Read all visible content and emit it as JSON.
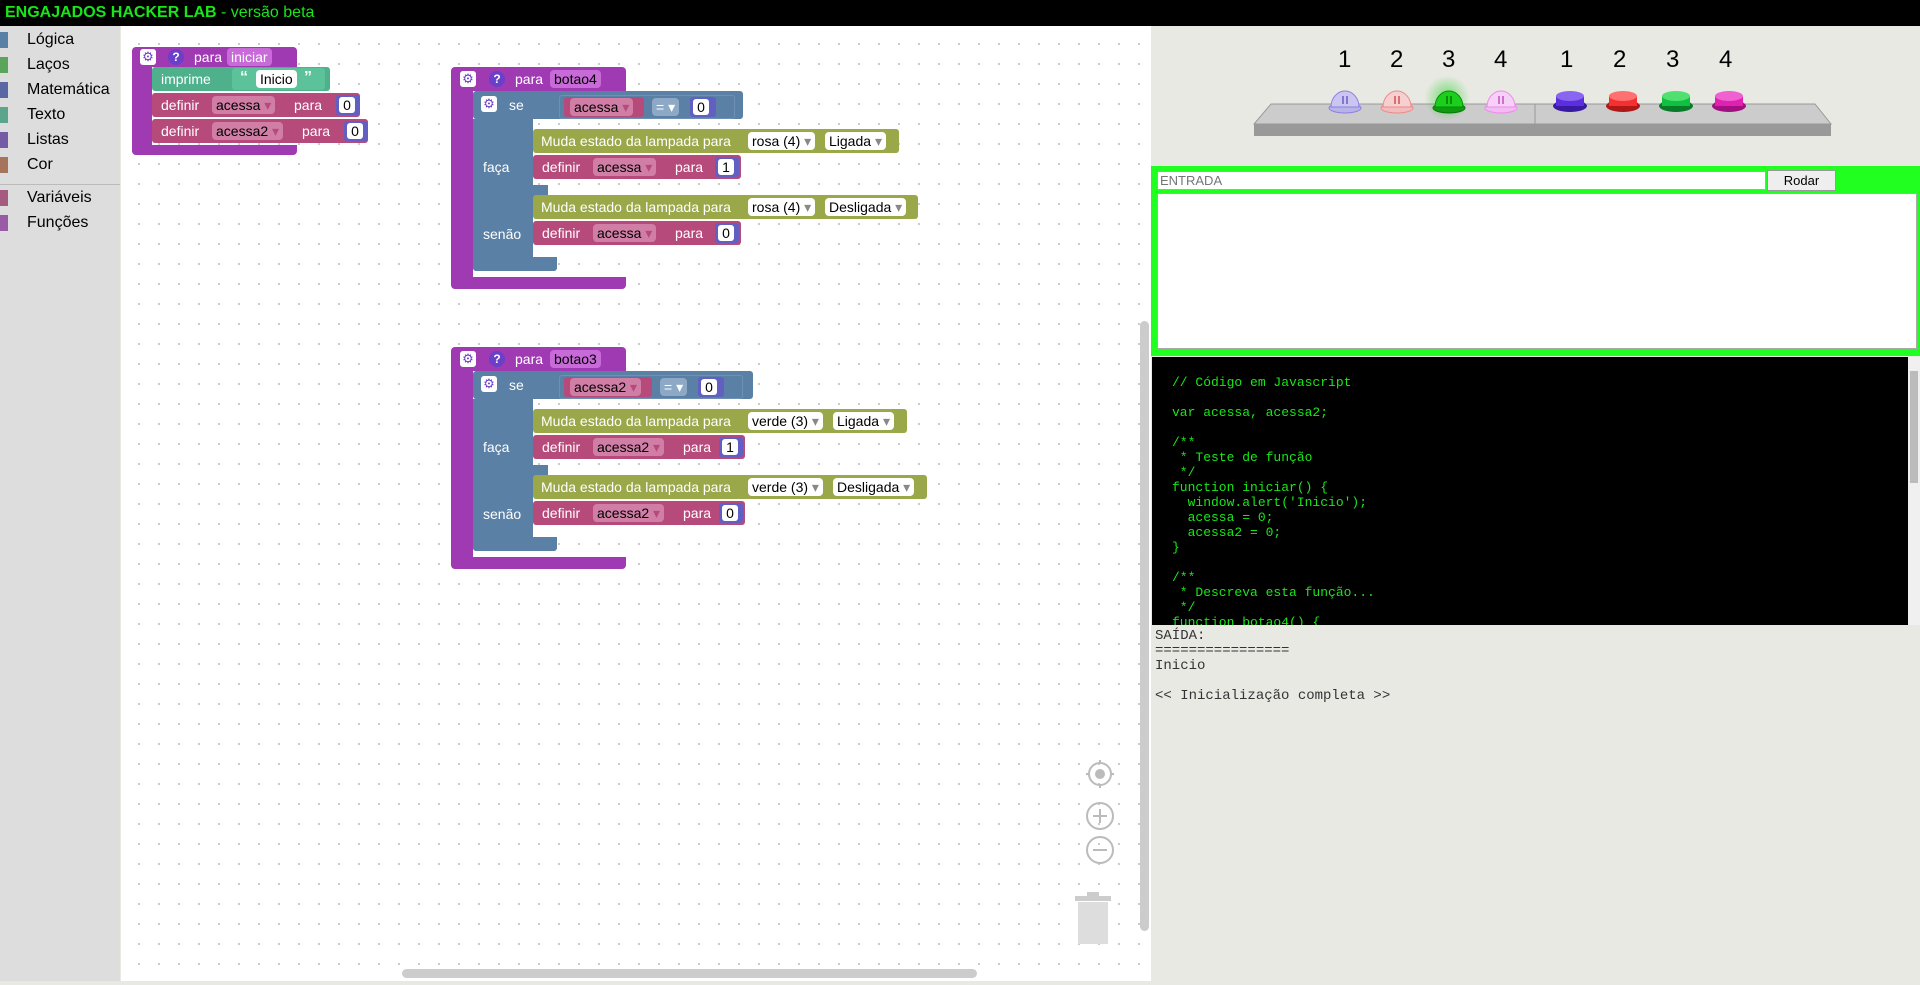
{
  "header": {
    "brand": "ENGAJADOS HACKER LAB",
    "suffix": " - versão beta"
  },
  "toolbox": {
    "items": [
      {
        "label": "Lógica",
        "color": "#5b80a5"
      },
      {
        "label": "Laços",
        "color": "#5ba55b"
      },
      {
        "label": "Matemática",
        "color": "#5b67a5"
      },
      {
        "label": "Texto",
        "color": "#5ba58c"
      },
      {
        "label": "Listas",
        "color": "#745ba5"
      },
      {
        "label": "Cor",
        "color": "#a5745b"
      },
      {
        "label": "Variáveis",
        "color": "#a55b80"
      },
      {
        "label": "Funções",
        "color": "#995ba5"
      }
    ]
  },
  "blocks": {
    "iniciar": {
      "para": "para",
      "name": "iniciar",
      "print": "imprime",
      "print_text": "Inicio",
      "define": "definir",
      "var1": "acessa",
      "var2": "acessa2",
      "to": "para",
      "val1": "0",
      "val2": "0"
    },
    "botao4": {
      "para": "para",
      "name": "botao4",
      "if": "se",
      "do": "faça",
      "else": "senão",
      "cond_var": "acessa",
      "op": "=",
      "cond_val": "0",
      "lamp_text": "Muda estado da lampada para",
      "lamp": "rosa (4)",
      "state_on": "Ligada",
      "state_off": "Desligada",
      "define": "definir",
      "var": "acessa",
      "to": "para",
      "val_on": "1",
      "val_off": "0"
    },
    "botao3": {
      "para": "para",
      "name": "botao3",
      "if": "se",
      "do": "faça",
      "else": "senão",
      "cond_var": "acessa2",
      "op": "=",
      "cond_val": "0",
      "lamp_text": "Muda estado da lampada para",
      "lamp": "verde (3)",
      "state_on": "Ligada",
      "state_off": "Desligada",
      "define": "definir",
      "var": "acessa2",
      "to": "para",
      "val_on": "1",
      "val_off": "0"
    }
  },
  "hardware": {
    "lamp_numbers": [
      "1",
      "2",
      "3",
      "4"
    ],
    "button_numbers": [
      "1",
      "2",
      "3",
      "4"
    ],
    "lamp_colors": [
      "#8a7ee6",
      "#ee8888",
      "#1bd01b",
      "#ee88ee"
    ],
    "lamps_on": [
      false,
      false,
      true,
      false
    ],
    "button_colors": [
      "#5b2ee0",
      "#f53030",
      "#10c040",
      "#e020b0"
    ]
  },
  "input": {
    "placeholder": "ENTRADA",
    "run": "Rodar"
  },
  "code": "// Código em Javascript\n\nvar acessa, acessa2;\n\n/**\n * Teste de função\n */\nfunction iniciar() {\n  window.alert('Inicio');\n  acessa = 0;\n  acessa2 = 0;\n}\n\n/**\n * Descreva esta função...\n */\nfunction botao4() {",
  "output": {
    "lines": [
      "SAÍDA:",
      "================",
      "Inicio",
      "",
      "<< Inicialização completa >>"
    ]
  }
}
